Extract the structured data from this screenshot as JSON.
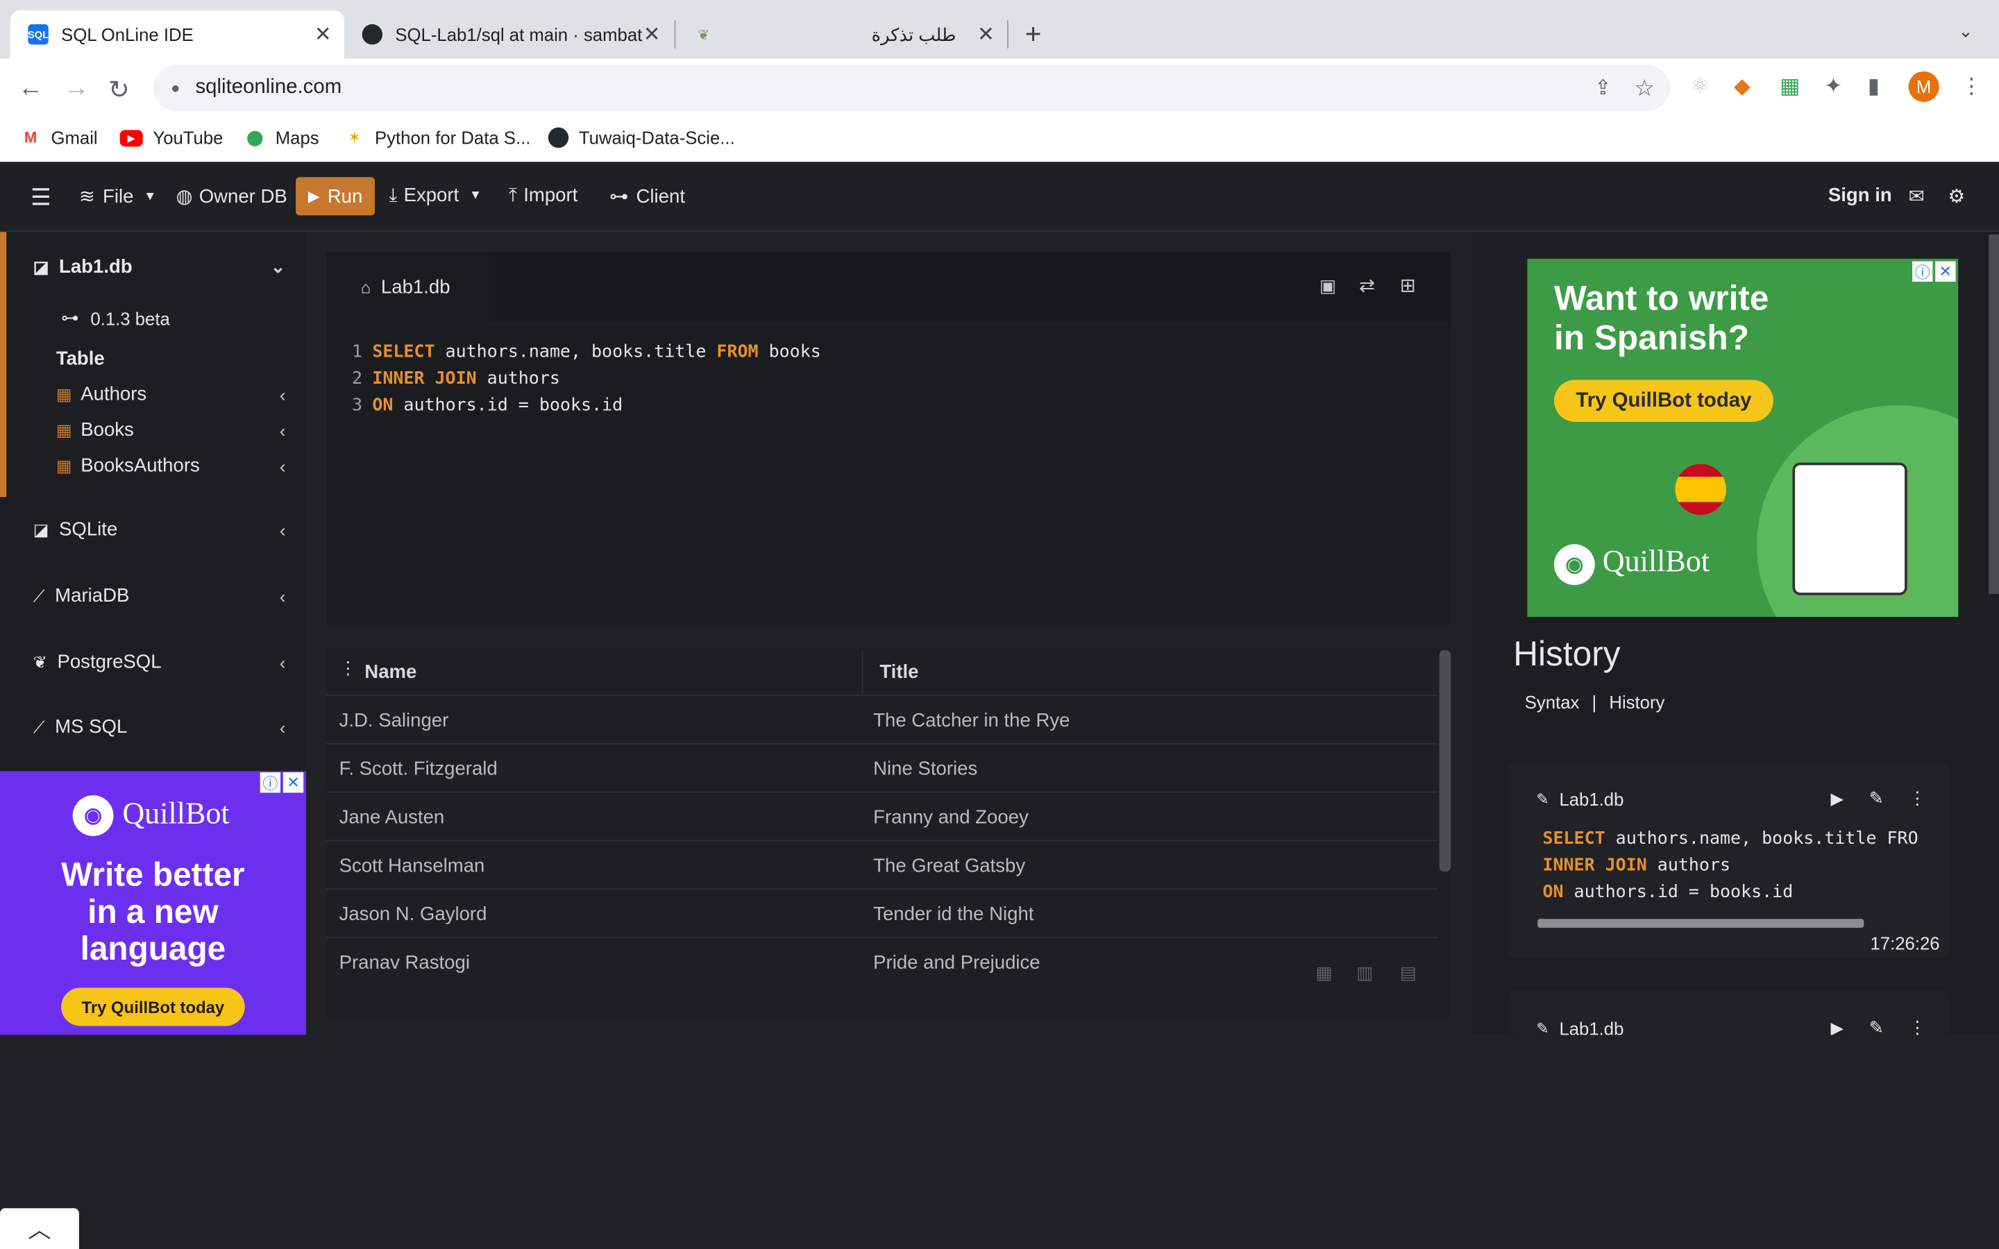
{
  "browser": {
    "tabs": [
      {
        "title": "SQL OnLine IDE",
        "active": true
      },
      {
        "title": "SQL-Lab1/sql at main · sambat",
        "active": false
      },
      {
        "title": "طلب تذكرة",
        "active": false
      }
    ],
    "url": "sqliteonline.com",
    "bookmarks": [
      "Gmail",
      "YouTube",
      "Maps",
      "Python for Data S...",
      "Tuwaiq-Data-Scie..."
    ],
    "profile_initial": "M"
  },
  "menu": {
    "file": "File",
    "owner_db": "Owner DB",
    "run": "Run",
    "export": "Export",
    "import": "Import",
    "client": "Client",
    "sign_in": "Sign in"
  },
  "sidebar": {
    "db_name": "Lab1.db",
    "version": "0.1.3 beta",
    "table_heading": "Table",
    "tables": [
      "Authors",
      "Books",
      "BooksAuthors"
    ],
    "engines": [
      "SQLite",
      "MariaDB",
      "PostgreSQL",
      "MS SQL"
    ]
  },
  "ad_left": {
    "brand": "QuillBot",
    "headline": [
      "Write better",
      "in a new",
      "language"
    ],
    "cta": "Try QuillBot today"
  },
  "editor": {
    "tab": "Lab1.db",
    "lines": [
      {
        "n": "1",
        "k1": "SELECT",
        "t1": " authors.name, books.title ",
        "k2": "FROM",
        "t2": " books"
      },
      {
        "n": "2",
        "k1": "INNER JOIN",
        "t1": " authors",
        "k2": "",
        "t2": ""
      },
      {
        "n": "3",
        "k1": "ON",
        "t1": " authors.id = books.id",
        "k2": "",
        "t2": ""
      }
    ]
  },
  "results": {
    "columns": [
      "Name",
      "Title"
    ],
    "rows": [
      [
        "J.D. Salinger",
        "The Catcher in the Rye"
      ],
      [
        "F. Scott. Fitzgerald",
        "Nine Stories"
      ],
      [
        "Jane Austen",
        "Franny and Zooey"
      ],
      [
        "Scott Hanselman",
        "The Great Gatsby"
      ],
      [
        "Jason N. Gaylord",
        "Tender id the Night"
      ],
      [
        "Pranav Rastogi",
        "Pride and Prejudice"
      ]
    ]
  },
  "ad_right": {
    "headline": [
      "Want to write",
      "in Spanish?"
    ],
    "cta": "Try QuillBot today",
    "brand": "QuillBot"
  },
  "history": {
    "title": "History",
    "nav_syntax": "Syntax",
    "nav_sep": "|",
    "nav_history": "History",
    "entries": [
      {
        "db": "Lab1.db",
        "k1": "SELECT",
        "t1": " authors.name, books.title FRO",
        "k2": "INNER JOIN",
        "t2": " authors",
        "k3": "ON",
        "t3": " authors.id = books.id",
        "time": "17:26:26"
      },
      {
        "db": "Lab1.db"
      }
    ]
  },
  "colors": {
    "accent": "#c6782f",
    "keyword": "#e8902c",
    "ad_green": "#3d9b46",
    "ad_purple": "#6c2ff0"
  }
}
